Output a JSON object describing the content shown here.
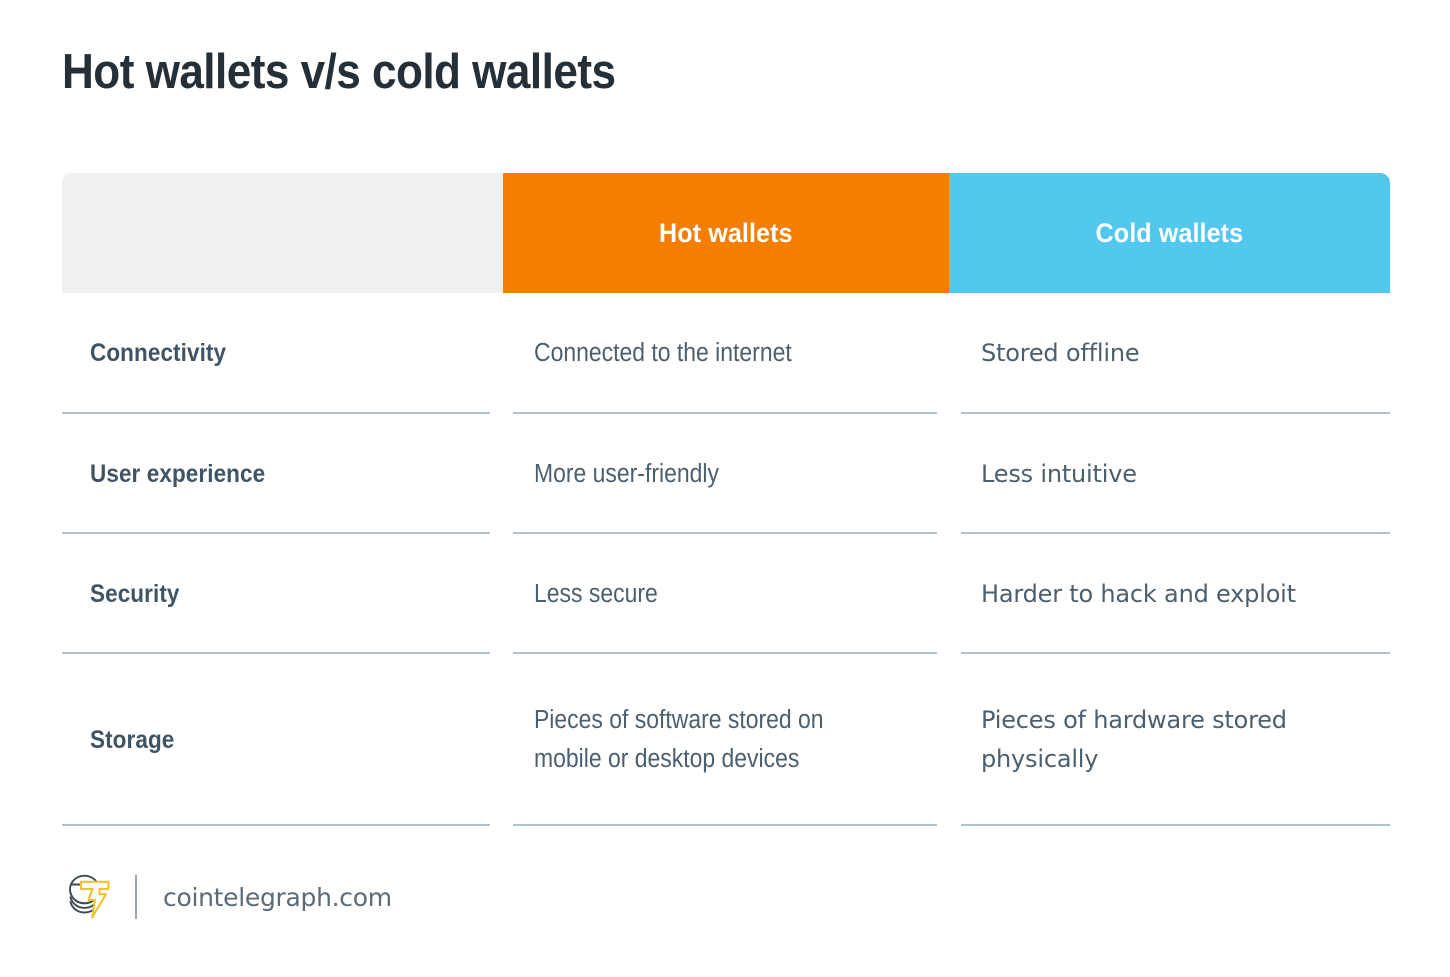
{
  "title": "Hot wallets v/s cold wallets",
  "colors": {
    "hot_header_bg": "#f57e00",
    "cold_header_bg": "#52c8ef",
    "label_header_bg": "#f0f0f0",
    "title_text": "#242f38",
    "label_text": "#3f5464",
    "body_text": "#4c5f6e",
    "divider": "#b2c1cc",
    "logo_accent": "#f2c230",
    "page_bg": "#ffffff"
  },
  "table": {
    "headers": {
      "attribute": "",
      "hot": "Hot wallets",
      "cold": "Cold wallets"
    },
    "rows": [
      {
        "attribute": "Connectivity",
        "hot": "Connected to the internet",
        "cold": "Stored offline"
      },
      {
        "attribute": "User experience",
        "hot": "More user-friendly",
        "cold": "Less intuitive"
      },
      {
        "attribute": "Security",
        "hot": "Less secure",
        "cold": "Harder to hack and exploit"
      },
      {
        "attribute": "Storage",
        "hot": "Pieces of software stored on mobile or desktop devices",
        "cold": "Pieces of hardware stored physically"
      }
    ]
  },
  "footer": {
    "logo_icon": "cointelegraph-coin-stack-bolt-logo",
    "site": "cointelegraph.com"
  }
}
